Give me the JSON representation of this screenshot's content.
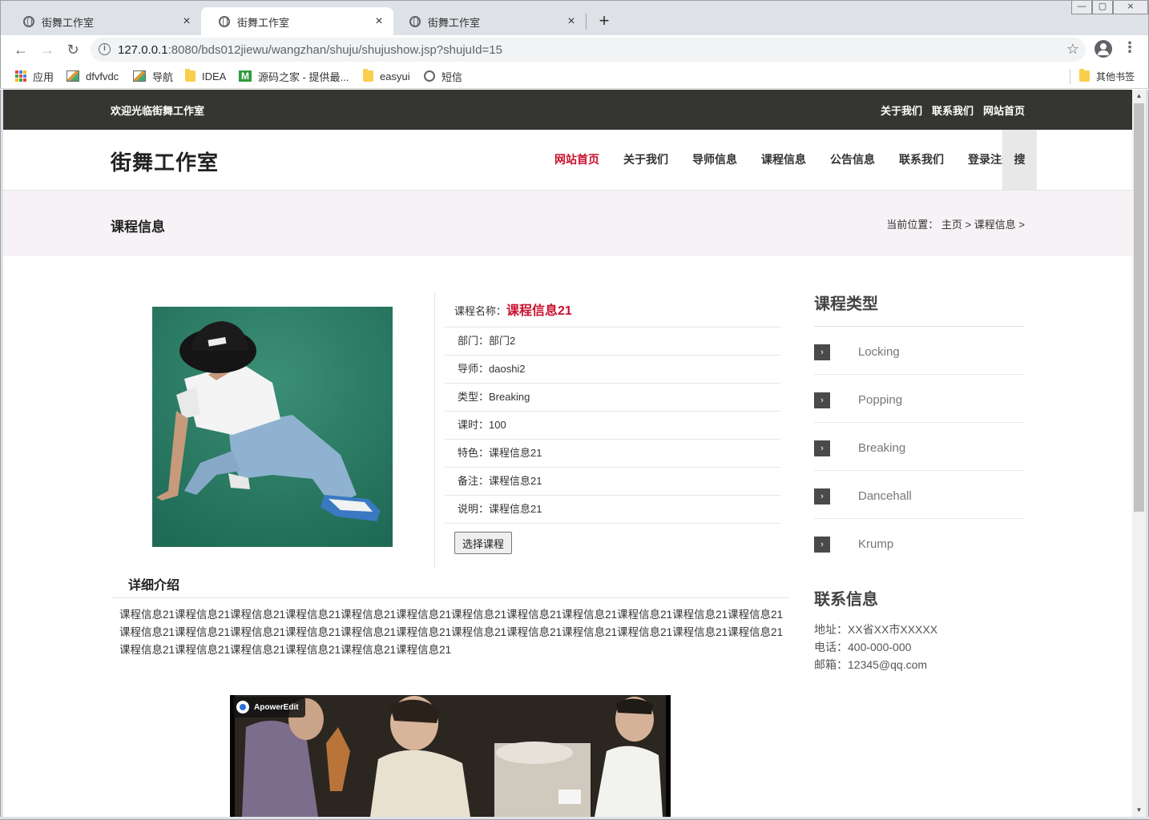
{
  "browser": {
    "tabs": [
      {
        "title": "街舞工作室",
        "close": "×"
      },
      {
        "title": "街舞工作室",
        "close": "×"
      },
      {
        "title": "街舞工作室",
        "close": "×"
      }
    ],
    "new_tab": "+",
    "window_controls": {
      "minimize": "—",
      "maximize": "▢",
      "close": "⨯"
    },
    "url_host": "127.0.0.1",
    "url_rest": ":8080/bds012jiewu/wangzhan/shuju/shujushow.jsp?shujuId=15",
    "bookmarks": [
      {
        "label": "应用",
        "icon": "apps-icon"
      },
      {
        "label": "dfvfvdc",
        "icon": "image-icon"
      },
      {
        "label": "导航",
        "icon": "image-icon"
      },
      {
        "label": "IDEA",
        "icon": "folder-icon"
      },
      {
        "label": "源码之家 - 提供最...",
        "icon": "m-icon"
      },
      {
        "label": "easyui",
        "icon": "folder-icon"
      },
      {
        "label": "短信",
        "icon": "globe-icon"
      }
    ],
    "other_bookmarks": "其他书签"
  },
  "site": {
    "welcome": "欢迎光临街舞工作室",
    "top_links": [
      "关于我们",
      "联系我们",
      "网站首页"
    ],
    "logo": "街舞工作室",
    "nav": [
      "网站首页",
      "关于我们",
      "导师信息",
      "课程信息",
      "公告信息",
      "联系我们",
      "登录注册"
    ],
    "search": "搜",
    "accent_color": "#c8102e"
  },
  "pagehead": {
    "title": "课程信息",
    "crumb_prefix": "当前位置：",
    "crumb_home": "主页",
    "crumb_sep1": " > ",
    "crumb_current": "课程信息",
    "crumb_sep2": " >"
  },
  "course": {
    "name_label": "课程名称：",
    "name": "课程信息21",
    "fields": [
      "部门：部门2",
      "导师：daoshi2",
      "类型：Breaking",
      "课时：100",
      "特色：课程信息21",
      "备注：课程信息21",
      "说明：课程信息21"
    ],
    "choose_button": "选择课程"
  },
  "detail": {
    "title": "详细介绍",
    "text": "课程信息21课程信息21课程信息21课程信息21课程信息21课程信息21课程信息21课程信息21课程信息21课程信息21课程信息21课程信息21课程信息21课程信息21课程信息21课程信息21课程信息21课程信息21课程信息21课程信息21课程信息21课程信息21课程信息21课程信息21课程信息21课程信息21课程信息21课程信息21课程信息21课程信息21"
  },
  "video": {
    "watermark": "ApowerEdit"
  },
  "sidebar": {
    "categories_title": "课程类型",
    "categories": [
      "Locking",
      "Popping",
      "Breaking",
      "Dancehall",
      "Krump"
    ],
    "contact_title": "联系信息",
    "contact": [
      "地址：XX省XX市XXXXX",
      "电话：400-000-000",
      "邮箱：12345@qq.com"
    ]
  }
}
